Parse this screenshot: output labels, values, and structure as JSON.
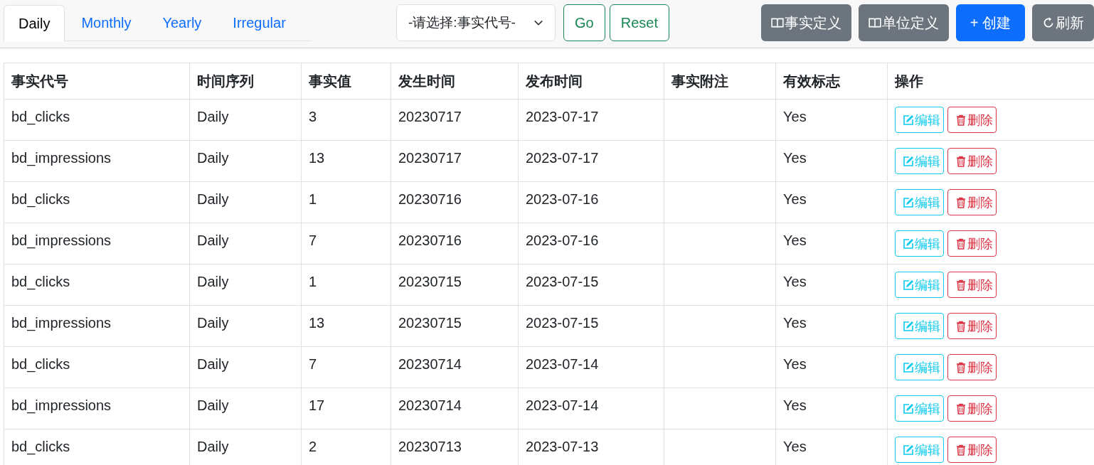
{
  "tabs": [
    {
      "label": "Daily",
      "selected": true
    },
    {
      "label": "Monthly",
      "selected": false
    },
    {
      "label": "Yearly",
      "selected": false
    },
    {
      "label": "Irregular",
      "selected": false
    }
  ],
  "filter": {
    "select_value": "-请选择:事实代号-",
    "go_label": "Go",
    "reset_label": "Reset"
  },
  "toolbar": [
    {
      "label": "事实定义",
      "kind": "definition"
    },
    {
      "label": "单位定义",
      "kind": "definition"
    },
    {
      "label": "+ 创建",
      "kind": "create"
    },
    {
      "label": "刷新",
      "kind": "refresh"
    }
  ],
  "table": {
    "columns": [
      "事实代号",
      "时间序列",
      "事实值",
      "发生时间",
      "发布时间",
      "事实附注",
      "有效标志",
      "操作"
    ],
    "rows": [
      {
        "cells": [
          "bd_clicks",
          "Daily",
          "3",
          "20230717",
          "2023-07-17",
          "",
          "Yes"
        ],
        "edit": "编辑",
        "delete": "删除"
      },
      {
        "cells": [
          "bd_impressions",
          "Daily",
          "13",
          "20230717",
          "2023-07-17",
          "",
          "Yes"
        ],
        "edit": "编辑",
        "delete": "删除"
      },
      {
        "cells": [
          "bd_clicks",
          "Daily",
          "1",
          "20230716",
          "2023-07-16",
          "",
          "Yes"
        ],
        "edit": "编辑",
        "delete": "删除"
      },
      {
        "cells": [
          "bd_impressions",
          "Daily",
          "7",
          "20230716",
          "2023-07-16",
          "",
          "Yes"
        ],
        "edit": "编辑",
        "delete": "删除"
      },
      {
        "cells": [
          "bd_clicks",
          "Daily",
          "1",
          "20230715",
          "2023-07-15",
          "",
          "Yes"
        ],
        "edit": "编辑",
        "delete": "删除"
      },
      {
        "cells": [
          "bd_impressions",
          "Daily",
          "13",
          "20230715",
          "2023-07-15",
          "",
          "Yes"
        ],
        "edit": "编辑",
        "delete": "删除"
      },
      {
        "cells": [
          "bd_clicks",
          "Daily",
          "7",
          "20230714",
          "2023-07-14",
          "",
          "Yes"
        ],
        "edit": "编辑",
        "delete": "删除"
      },
      {
        "cells": [
          "bd_impressions",
          "Daily",
          "17",
          "20230714",
          "2023-07-14",
          "",
          "Yes"
        ],
        "edit": "编辑",
        "delete": "删除"
      },
      {
        "cells": [
          "bd_clicks",
          "Daily",
          "2",
          "20230713",
          "2023-07-13",
          "",
          "Yes"
        ],
        "edit": "编辑",
        "delete": "删除"
      }
    ]
  }
}
